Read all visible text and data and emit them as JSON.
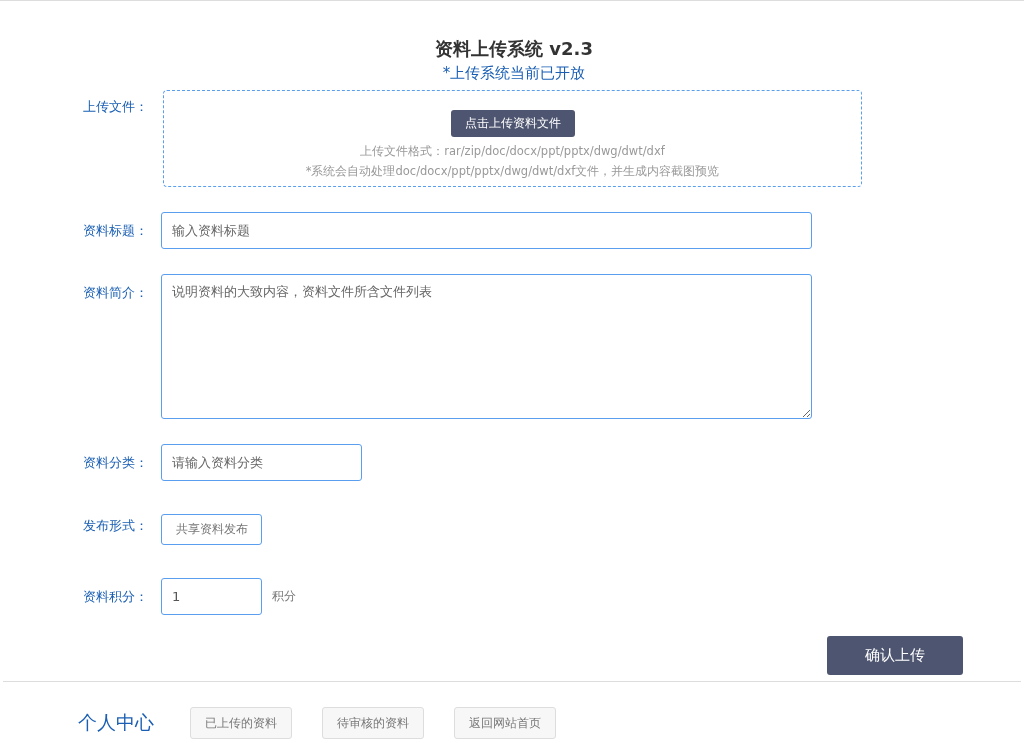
{
  "header": {
    "title": "资料上传系统 v2.3",
    "subtitle": "*上传系统当前已开放"
  },
  "upload": {
    "label": "上传文件：",
    "button": "点击上传资料文件",
    "formats": "上传文件格式：rar/zip/doc/docx/ppt/pptx/dwg/dwt/dxf",
    "note": "*系统会自动处理doc/docx/ppt/pptx/dwg/dwt/dxf文件，并生成内容截图预览"
  },
  "fields": [
    {
      "kind": "input",
      "label": "资料标题：",
      "placeholder": "输入资料标题"
    },
    {
      "kind": "textarea",
      "label": "资料简介：",
      "placeholder": "说明资料的大致内容，资料文件所含文件列表"
    },
    {
      "kind": "input",
      "label": "资料分类：",
      "placeholder": "请输入资料分类"
    },
    {
      "kind": "choice",
      "label": "发布形式：",
      "option": "共享资料发布"
    },
    {
      "kind": "input",
      "label": "资料积分：",
      "value": "1",
      "unit": "积分"
    }
  ],
  "submit": "确认上传",
  "footer": {
    "title": "个人中心",
    "links": [
      "已上传的资料",
      "待审核的资料",
      "返回网站首页"
    ]
  }
}
